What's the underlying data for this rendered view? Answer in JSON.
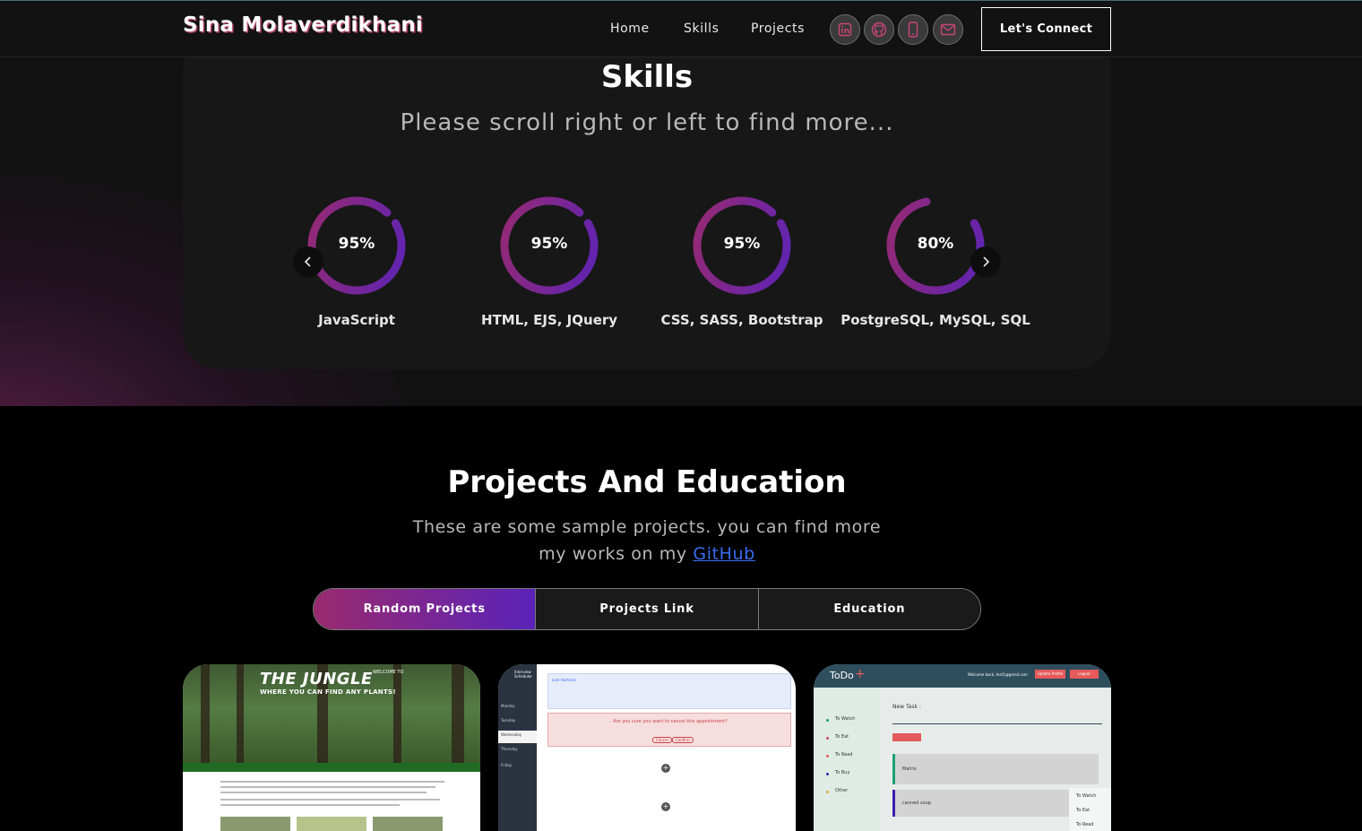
{
  "navbar": {
    "brand": "Sina Molaverdikhani",
    "links": [
      "Home",
      "Skills",
      "Projects"
    ],
    "social_icons": [
      "linkedin-icon",
      "github-icon",
      "phone-icon",
      "mail-icon"
    ],
    "connect_label": "Let's Connect"
  },
  "skills": {
    "title": "Skills",
    "subtitle": "Please scroll right or left to find more...",
    "items": [
      {
        "name": "JavaScript",
        "percent": "95%",
        "value": 95
      },
      {
        "name": "HTML, EJS, JQuery",
        "percent": "95%",
        "value": 95
      },
      {
        "name": "CSS, SASS, Bootstrap",
        "percent": "95%",
        "value": 95
      },
      {
        "name": "PostgreSQL, MySQL, SQL",
        "percent": "80%",
        "value": 80
      }
    ],
    "ring_gradient": [
      "#9a2a6e",
      "#5a23b8"
    ]
  },
  "projects": {
    "title": "Projects And Education",
    "desc_before": "These are some sample projects. you can find more my works on my ",
    "desc_link": "GitHub",
    "tabs": [
      "Random Projects",
      "Projects Link",
      "Education"
    ],
    "active_tab": 0,
    "jungle": {
      "title": "THE JUNGLE",
      "welcome": "WELCOME TO",
      "tagline": "WHERE YOU CAN FIND ANY PLANTS!"
    },
    "scheduler": {
      "app_name": "Interview Scheduler",
      "days": [
        "Monday",
        "Tuesday",
        "Wednesday",
        "Thursday",
        "Friday"
      ],
      "appointment": "Lam Hartinez",
      "confirm_text": "Are you sure you want to cancel this appointment?",
      "cancel": "Cancel",
      "confirm": "Confirm"
    },
    "todo": {
      "title": "ToDo",
      "welcome": "Welcome back, test1@gmail.com",
      "update_profile": "Update Profile",
      "logout": "Logout",
      "categories": [
        "To Watch",
        "To Eat",
        "To Read",
        "To Buy",
        "Other"
      ],
      "new_task_label": "New Task :",
      "tasks": [
        "Matrix",
        "canned soup"
      ],
      "dropdown": [
        "To Watch",
        "To Eat",
        "To Read"
      ]
    }
  }
}
